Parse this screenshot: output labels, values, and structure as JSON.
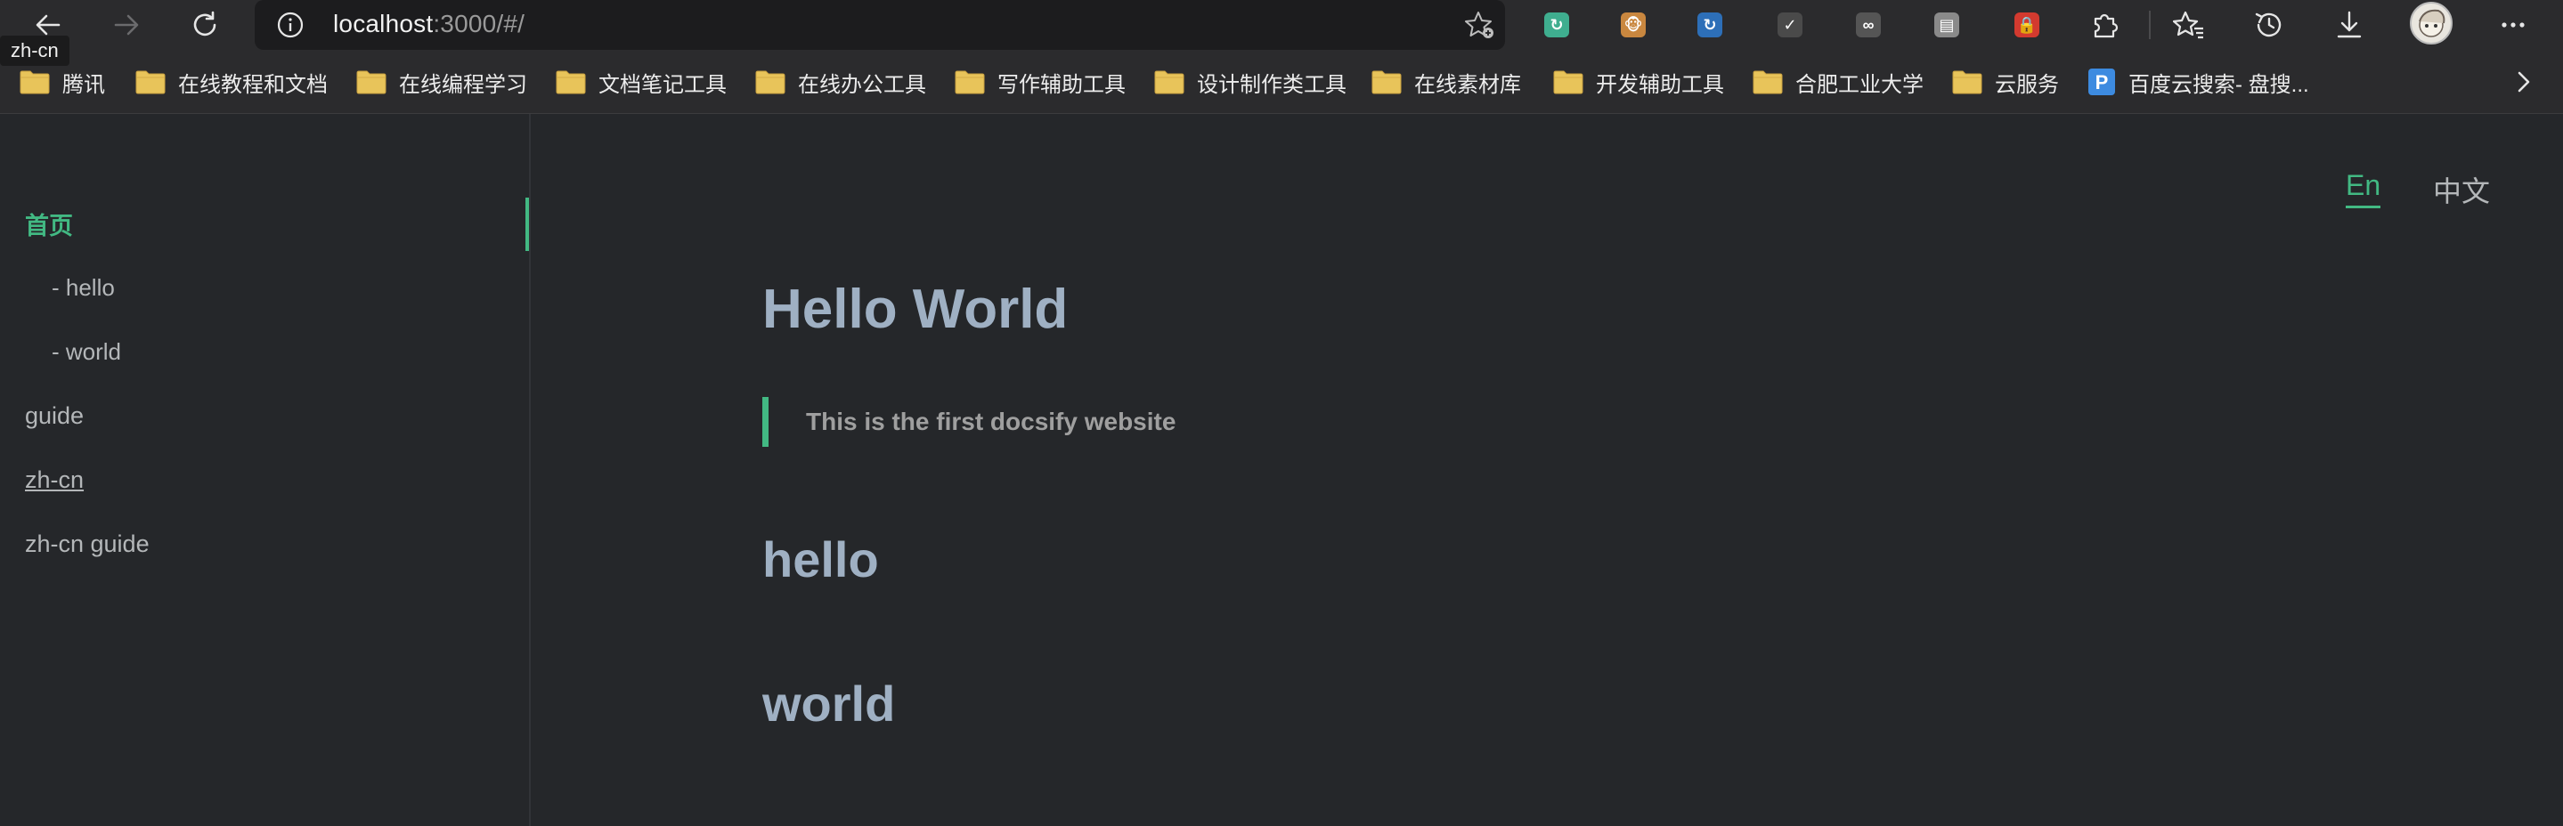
{
  "browser": {
    "url_host": "localhost",
    "url_rest": ":3000/#/",
    "tooltip": "zh-cn",
    "extensions": [
      {
        "icon": "refresh-extension-icon",
        "color": "#3fae8f",
        "glyph": "↻"
      },
      {
        "icon": "monkey-extension-icon",
        "color": "#c9873f",
        "glyph": "🐵"
      },
      {
        "icon": "sync-extension-icon",
        "color": "#2d6fb8",
        "glyph": "↻"
      },
      {
        "icon": "check-extension-icon",
        "color": "#4a4a4a",
        "glyph": "✓"
      },
      {
        "icon": "glasses-extension-icon",
        "color": "#555555",
        "glyph": "∞"
      },
      {
        "icon": "reader-extension-icon",
        "color": "#8a8a8a",
        "glyph": "▤"
      },
      {
        "icon": "shield-extension-icon",
        "color": "#d33a2f",
        "glyph": "🔒"
      }
    ]
  },
  "bookmarks": [
    {
      "label": "腾讯"
    },
    {
      "label": "在线教程和文档"
    },
    {
      "label": "在线编程学习"
    },
    {
      "label": "文档笔记工具"
    },
    {
      "label": "在线办公工具"
    },
    {
      "label": "写作辅助工具"
    },
    {
      "label": "设计制作类工具"
    },
    {
      "label": "在线素材库"
    },
    {
      "label": "开发辅助工具"
    },
    {
      "label": "合肥工业大学"
    },
    {
      "label": "云服务"
    },
    {
      "label": "百度云搜索- 盘搜..."
    }
  ],
  "sidebar": {
    "items": [
      {
        "label": "首页"
      },
      {
        "label": "- hello"
      },
      {
        "label": "- world"
      },
      {
        "label": "guide"
      },
      {
        "label": "zh-cn"
      },
      {
        "label": "zh-cn guide"
      }
    ]
  },
  "lang_switch": {
    "en": "En",
    "zh": "中文"
  },
  "content": {
    "title": "Hello World",
    "quote": "This is the first docsify website",
    "headings": [
      "hello",
      "world"
    ]
  },
  "colors": {
    "accent": "#42b983",
    "background": "#25272a",
    "heading": "#9fb0c3"
  }
}
